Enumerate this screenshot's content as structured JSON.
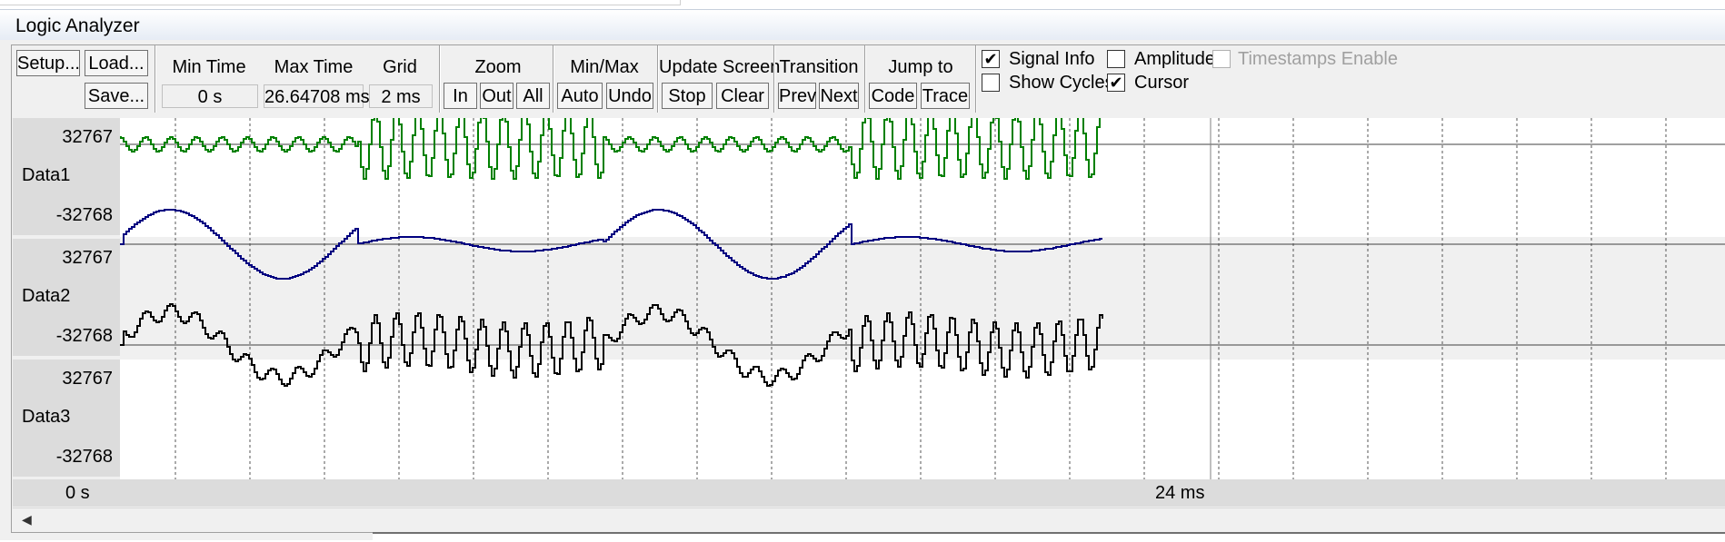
{
  "window": {
    "title": "Logic Analyzer"
  },
  "toolbar": {
    "setup": "Setup...",
    "load": "Load...",
    "save": "Save...",
    "min_time": {
      "label": "Min Time",
      "value": "0 s"
    },
    "max_time": {
      "label": "Max Time",
      "value": "26.64708 ms"
    },
    "grid": {
      "label": "Grid",
      "value": "2 ms"
    },
    "zoom": {
      "label": "Zoom",
      "in": "In",
      "out": "Out",
      "all": "All"
    },
    "minmax": {
      "label": "Min/Max",
      "auto": "Auto",
      "undo": "Undo"
    },
    "update_screen": {
      "label": "Update Screen",
      "stop": "Stop",
      "clear": "Clear"
    },
    "transition": {
      "label": "Transition",
      "prev": "Prev",
      "next": "Next"
    },
    "jump_to": {
      "label": "Jump to",
      "code": "Code",
      "trace": "Trace"
    },
    "options": {
      "signal_info": {
        "label": "Signal Info",
        "checked": true
      },
      "show_cycles": {
        "label": "Show Cycles",
        "checked": false
      },
      "amplitude": {
        "label": "Amplitude",
        "checked": false
      },
      "cursor": {
        "label": "Cursor",
        "checked": true
      },
      "timestamps": {
        "label": "Timestamps Enable",
        "checked": false,
        "enabled": false
      }
    }
  },
  "signals": [
    {
      "name": "Data1",
      "max": "32767",
      "min": "-32768",
      "color": "#008000"
    },
    {
      "name": "Data2",
      "max": "32767",
      "min": "-32768",
      "color": "#000080"
    },
    {
      "name": "Data3",
      "max": "32767",
      "min": "-32768",
      "color": "#000000"
    }
  ],
  "time_axis": {
    "start": "0 s",
    "cursor_label": "24 ms"
  },
  "colors": {
    "lane_band": "#f0f0f0",
    "grid": "#555555",
    "cursor_line": "#808080"
  }
}
